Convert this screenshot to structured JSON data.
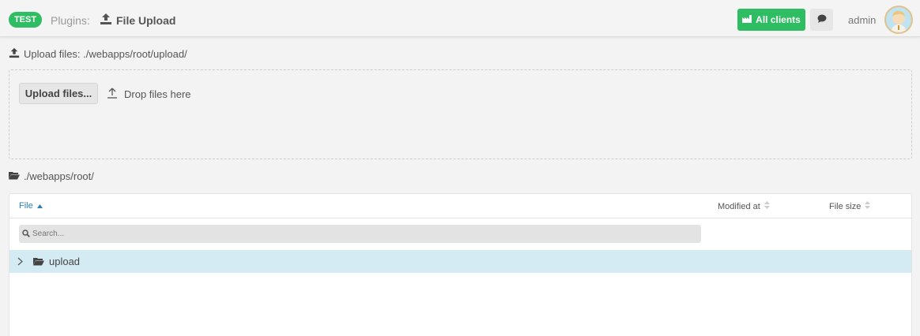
{
  "header": {
    "env_badge": "TEST",
    "breadcrumb_section": "Plugins:",
    "page_title": "File Upload",
    "clients_button": "All clients",
    "user_name": "admin"
  },
  "upload": {
    "heading": "Upload files: ./webapps/root/upload/",
    "button_label": "Upload files...",
    "drop_hint": "Drop files here"
  },
  "browser": {
    "path": "./webapps/root/",
    "columns": {
      "file": "File",
      "modified": "Modified at",
      "size": "File size"
    },
    "search_placeholder": "Search...",
    "rows": [
      {
        "name": "upload",
        "type": "folder"
      }
    ]
  },
  "colors": {
    "accent_green": "#2ebd63",
    "link_blue": "#2a7fb8",
    "selected_row": "#d5ebf3"
  }
}
